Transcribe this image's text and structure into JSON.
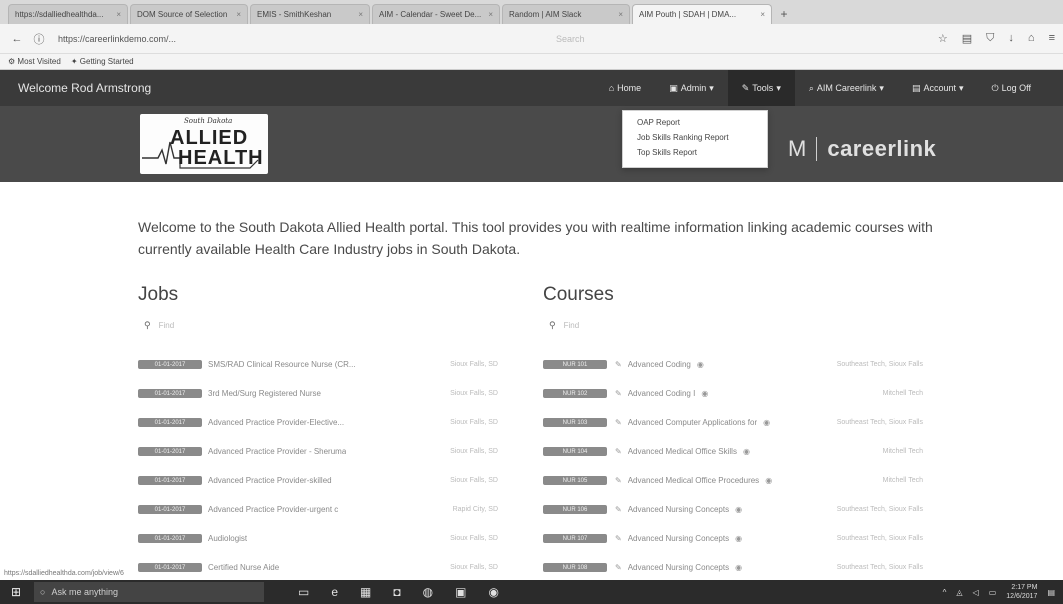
{
  "browser": {
    "tabs": [
      {
        "title": "https://sdalliedhealthda...",
        "active": false
      },
      {
        "title": "DOM Source of Selection",
        "active": false
      },
      {
        "title": "EMIS - SmithKeshan",
        "active": false
      },
      {
        "title": "AIM - Calendar - Sweet De...",
        "active": false
      },
      {
        "title": "Random | AIM Slack",
        "active": false
      },
      {
        "title": "AIM Pouth | SDAH | DMA...",
        "active": true
      }
    ],
    "url": "https://careerlinkdemo.com/...",
    "url_search_placeholder": "Search",
    "bookmarks": [
      "Most Visited",
      "Getting Started"
    ]
  },
  "appnav": {
    "welcome": "Welcome Rod Armstrong",
    "menu": [
      {
        "label": "Home",
        "icon": "home-icon",
        "glyph": "⌂",
        "active": false
      },
      {
        "label": "Admin",
        "icon": "briefcase-icon",
        "glyph": "▣",
        "active": false,
        "caret": true
      },
      {
        "label": "Tools",
        "icon": "wrench-icon",
        "glyph": "✎",
        "active": true,
        "caret": true
      },
      {
        "label": "AIM Careerlink",
        "icon": "search-icon",
        "glyph": "⌕",
        "active": false,
        "caret": true
      },
      {
        "label": "Account",
        "icon": "account-icon",
        "glyph": "▤",
        "active": false,
        "caret": true
      },
      {
        "label": "Log Off",
        "icon": "power-icon",
        "glyph": "⏻",
        "active": false
      }
    ],
    "tools_dropdown": [
      "OAP Report",
      "Job Skills Ranking Report",
      "Top Skills Report"
    ]
  },
  "hero": {
    "logo_small": "South Dakota",
    "logo_line1": "ALLIED",
    "logo_line2": "HEALTH",
    "brand_prefix": "M",
    "brand_name": "careerlink"
  },
  "intro": "Welcome to the South Dakota Allied Health portal. This tool provides you with realtime information linking academic courses with currently available Health Care Industry jobs in South Dakota.",
  "jobs": {
    "heading": "Jobs",
    "search_placeholder": "Find",
    "items": [
      {
        "badge": "01-01-2017",
        "title": "SMS/RAD Clinical Resource Nurse (CR...",
        "meta": "Sioux Falls, SD"
      },
      {
        "badge": "01-01-2017",
        "title": "3rd Med/Surg Registered Nurse",
        "meta": "Sioux Falls, SD"
      },
      {
        "badge": "01-01-2017",
        "title": "Advanced Practice Provider-Elective...",
        "meta": "Sioux Falls, SD"
      },
      {
        "badge": "01-01-2017",
        "title": "Advanced Practice Provider - Sheruma",
        "meta": "Sioux Falls, SD"
      },
      {
        "badge": "01-01-2017",
        "title": "Advanced Practice Provider-skilled",
        "meta": "Sioux Falls, SD"
      },
      {
        "badge": "01-01-2017",
        "title": "Advanced Practice Provider-urgent c",
        "meta": "Rapid City, SD"
      },
      {
        "badge": "01-01-2017",
        "title": "Audiologist",
        "meta": "Sioux Falls, SD"
      },
      {
        "badge": "01-01-2017",
        "title": "Certified Nurse Aide",
        "meta": "Sioux Falls, SD"
      }
    ]
  },
  "courses": {
    "heading": "Courses",
    "search_placeholder": "Find",
    "items": [
      {
        "badge": "NUR 101",
        "title": "Advanced Coding",
        "meta": "Southeast Tech, Sioux Falls"
      },
      {
        "badge": "NUR 102",
        "title": "Advanced Coding I",
        "meta": "Mitchell Tech"
      },
      {
        "badge": "NUR 103",
        "title": "Advanced Computer Applications for",
        "meta": "Southeast Tech, Sioux Falls"
      },
      {
        "badge": "NUR 104",
        "title": "Advanced Medical Office Skills",
        "meta": "Mitchell Tech"
      },
      {
        "badge": "NUR 105",
        "title": "Advanced Medical Office Procedures",
        "meta": "Mitchell Tech"
      },
      {
        "badge": "NUR 106",
        "title": "Advanced Nursing Concepts",
        "meta": "Southeast Tech, Sioux Falls"
      },
      {
        "badge": "NUR 107",
        "title": "Advanced Nursing Concepts",
        "meta": "Southeast Tech, Sioux Falls"
      },
      {
        "badge": "NUR 108",
        "title": "Advanced Nursing Concepts",
        "meta": "Southeast Tech, Sioux Falls"
      }
    ]
  },
  "status_url": "https://sdalliedhealthda.com/job/view/6",
  "taskbar": {
    "search_text": "Ask me anything",
    "clock_time": "2:17 PM",
    "clock_date": "12/6/2017"
  }
}
